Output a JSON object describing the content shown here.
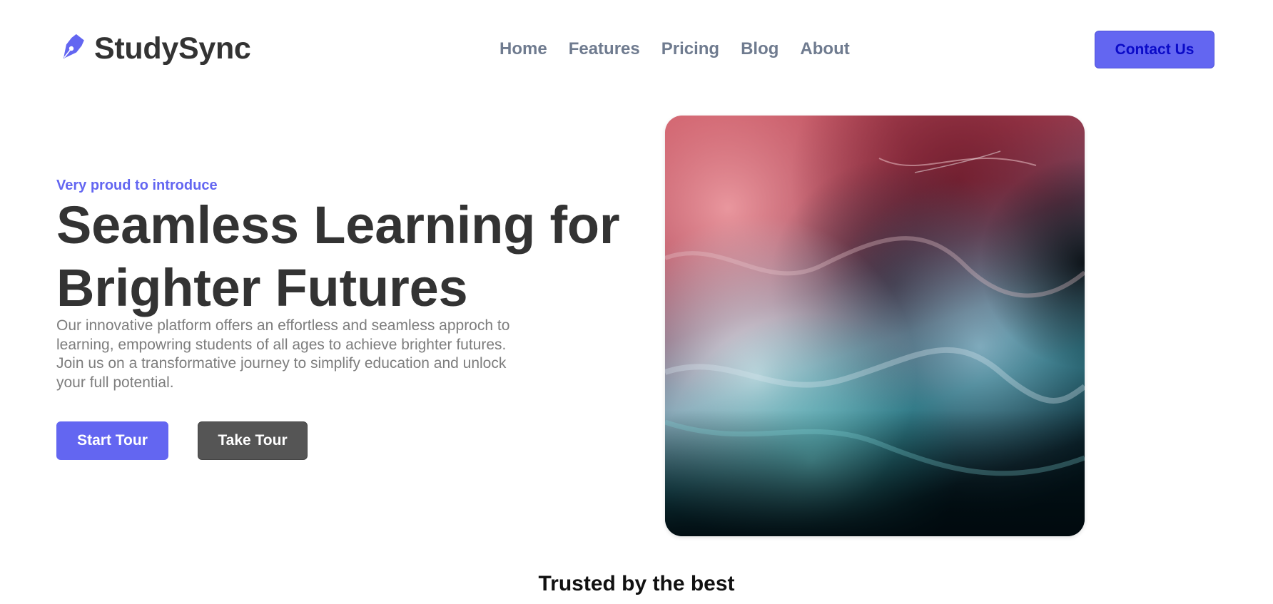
{
  "brand": {
    "name": "StudySync",
    "icon": "pen-nib-icon",
    "accent_color": "#6366f1"
  },
  "nav": {
    "items": [
      {
        "label": "Home"
      },
      {
        "label": "Features"
      },
      {
        "label": "Pricing"
      },
      {
        "label": "Blog"
      },
      {
        "label": "About"
      }
    ]
  },
  "header": {
    "contact_label": "Contact Us"
  },
  "hero": {
    "eyebrow": "Very proud to introduce",
    "title": "Seamless Learning for Brighter Futures",
    "description": "Our innovative platform offers an effortless and seamless approch to learning, empowring students of all ages to achieve brighter futures. Join us on a transformative journey to simplify education and unlock your full potential.",
    "primary_button": "Start Tour",
    "secondary_button": "Take Tour",
    "image": "abstract-fluid-art-image"
  },
  "trusted": {
    "heading": "Trusted by the best"
  }
}
